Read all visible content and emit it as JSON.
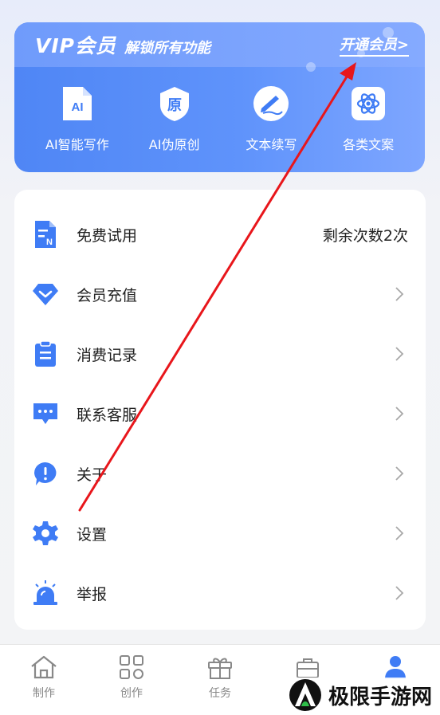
{
  "vip": {
    "title_main": "VIP会员",
    "title_sub": "解锁所有功能",
    "open_label": "开通会员>",
    "features": [
      {
        "label": "AI智能写作",
        "icon": "ai-doc-icon",
        "glyph": "AI"
      },
      {
        "label": "AI伪原创",
        "icon": "original-shield-icon",
        "glyph": "原"
      },
      {
        "label": "文本续写",
        "icon": "pen-write-icon",
        "glyph": ""
      },
      {
        "label": "各类文案",
        "icon": "atom-icon",
        "glyph": ""
      }
    ]
  },
  "menu": {
    "items": [
      {
        "label": "免费试用",
        "right": "剩余次数2次",
        "icon": "document-n-icon"
      },
      {
        "label": "会员充值",
        "icon": "diamond-icon"
      },
      {
        "label": "消费记录",
        "icon": "clipboard-icon"
      },
      {
        "label": "联系客服",
        "icon": "chat-bubble-icon"
      },
      {
        "label": "关于",
        "icon": "info-exclamation-icon"
      },
      {
        "label": "设置",
        "icon": "gear-icon"
      },
      {
        "label": "举报",
        "icon": "alarm-light-icon"
      }
    ]
  },
  "tabs": [
    {
      "label": "制作",
      "icon": "home-icon"
    },
    {
      "label": "创作",
      "icon": "grid-icon"
    },
    {
      "label": "任务",
      "icon": "gift-icon"
    },
    {
      "label": "",
      "icon": "bag-icon"
    },
    {
      "label": "",
      "icon": "user-icon"
    }
  ],
  "watermark": {
    "text": "极限手游网"
  },
  "colors": {
    "accent": "#3f7cf5",
    "vip_start": "#4f86f5",
    "vip_end": "#7ea6ff",
    "arrow": "#e8161b"
  }
}
